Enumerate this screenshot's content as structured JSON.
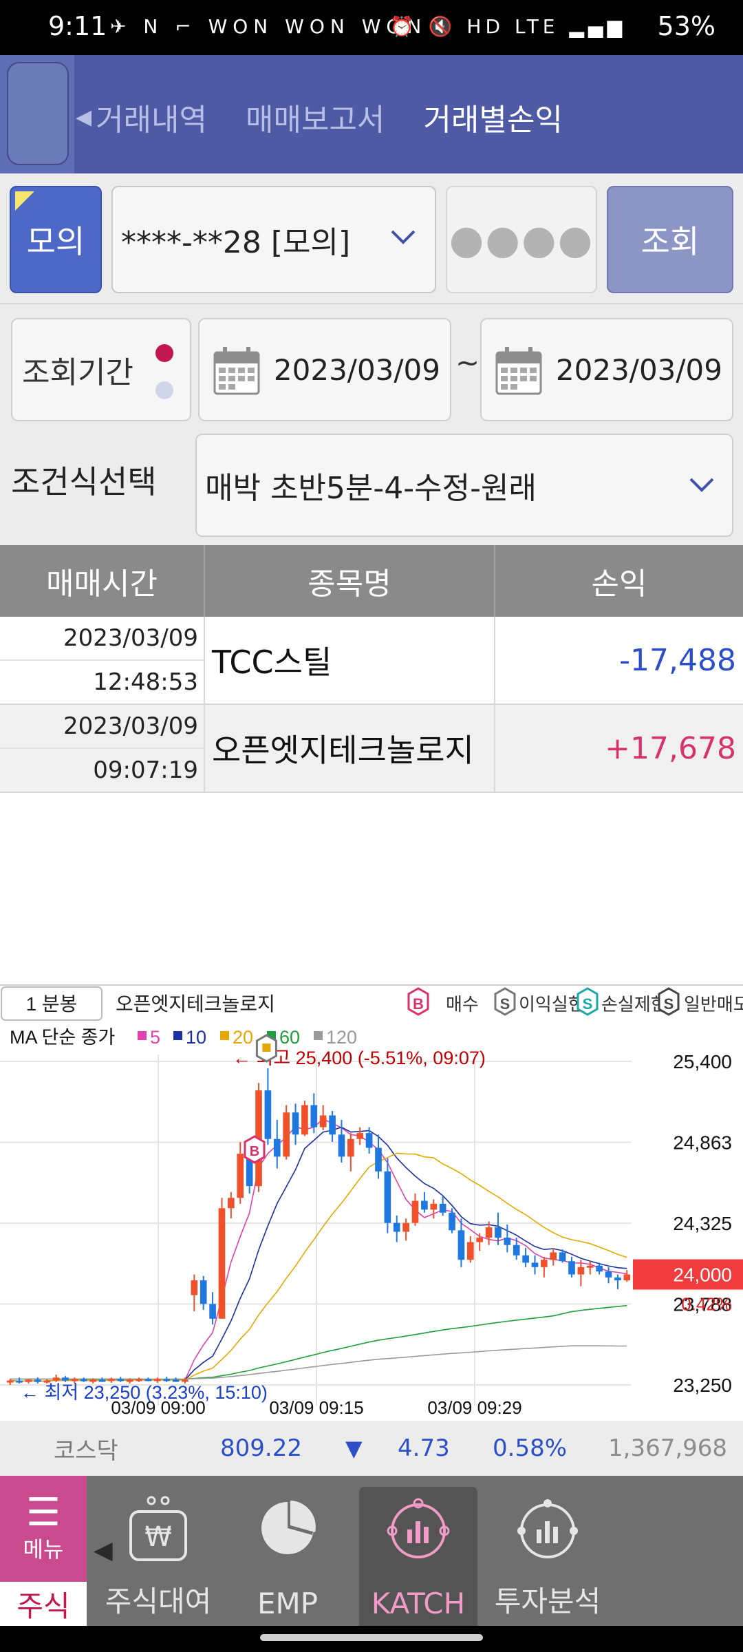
{
  "status_bar": {
    "time": "9:11",
    "notif_icons": "✈ N ⌐ WON WON WON •",
    "right_icons": "⏰ 🔇 HD LTE ▂▄▆",
    "battery": "53%"
  },
  "header": {
    "tabs": [
      {
        "label": "거래내역",
        "active": false
      },
      {
        "label": "매매보고서",
        "active": false
      },
      {
        "label": "거래별손익",
        "active": true
      }
    ]
  },
  "account": {
    "mode_button": "모의",
    "account_value": "****-**28 [모의]",
    "password_mask": "●●●●",
    "query_button": "조회"
  },
  "period": {
    "label": "조회기간",
    "start_date": "2023/03/09",
    "separator": "~",
    "end_date": "2023/03/09"
  },
  "condition": {
    "label": "조건식선택",
    "value": "매박 초반5분-4-수정-원래"
  },
  "table": {
    "headers": [
      "매매시간",
      "종목명",
      "손익"
    ],
    "rows": [
      {
        "date": "2023/03/09",
        "time": "12:48:53",
        "name": "TCC스틸",
        "pnl": "-17,488",
        "sign": "neg"
      },
      {
        "date": "2023/03/09",
        "time": "09:07:19",
        "name": "오픈엣지테크놀로지",
        "pnl": "+17,678",
        "sign": "pos"
      }
    ]
  },
  "chart_data": {
    "type": "candlestick",
    "period_button": "1 분봉",
    "stock_name": "오픈엣지테크놀로지",
    "legend_markers": [
      {
        "icon": "B",
        "label": "매수"
      },
      {
        "icon": "S",
        "label": "이익실현"
      },
      {
        "icon": "S",
        "label": "손실제한"
      },
      {
        "icon": "S",
        "label": "일반매도"
      }
    ],
    "ma_title": "MA 단순 종가",
    "ma_series": [
      {
        "name": "5",
        "color": "#e040b0"
      },
      {
        "name": "10",
        "color": "#1a2fa0"
      },
      {
        "name": "20",
        "color": "#e6a800"
      },
      {
        "name": "60",
        "color": "#1e9e3a"
      },
      {
        "name": "120",
        "color": "#9a9a9a"
      }
    ],
    "y_ticks": [
      "25,400",
      "24,863",
      "24,325",
      "23,788",
      "23,250"
    ],
    "ylim": [
      23250,
      25400
    ],
    "x_ticks": [
      "03/09 09:00",
      "03/09 09:15",
      "03/09 09:29"
    ],
    "high_annotation": "← 최고 25,400 (-5.51%, 09:07)",
    "low_annotation": "← 최저 23,250 (3.23%, 15:10)",
    "current_price": "24,000",
    "current_pct": "0.42%",
    "colors": {
      "up": "#f0502a",
      "down": "#1e78e0"
    },
    "candles": [
      [
        23270,
        23290,
        23250,
        23280
      ],
      [
        23280,
        23300,
        23260,
        23270
      ],
      [
        23270,
        23290,
        23260,
        23285
      ],
      [
        23285,
        23300,
        23260,
        23270
      ],
      [
        23270,
        23290,
        23260,
        23280
      ],
      [
        23280,
        23320,
        23270,
        23300
      ],
      [
        23300,
        23310,
        23270,
        23280
      ],
      [
        23280,
        23300,
        23260,
        23290
      ],
      [
        23290,
        23300,
        23270,
        23275
      ],
      [
        23275,
        23295,
        23260,
        23285
      ],
      [
        23285,
        23300,
        23270,
        23280
      ],
      [
        23280,
        23300,
        23265,
        23290
      ],
      [
        23290,
        23305,
        23270,
        23280
      ],
      [
        23280,
        23295,
        23260,
        23285
      ],
      [
        23285,
        23300,
        23270,
        23290
      ],
      [
        23290,
        23300,
        23275,
        23280
      ],
      [
        23280,
        23300,
        23265,
        23290
      ],
      [
        23290,
        23305,
        23270,
        23285
      ],
      [
        23285,
        23300,
        23270,
        23280
      ],
      [
        23280,
        23300,
        23260,
        23285
      ],
      [
        23860,
        24000,
        23750,
        23960
      ],
      [
        23960,
        23990,
        23760,
        23800
      ],
      [
        23800,
        23880,
        23660,
        23700
      ],
      [
        23700,
        24520,
        23700,
        24450
      ],
      [
        24450,
        24560,
        24380,
        24520
      ],
      [
        24520,
        24900,
        24480,
        24820
      ],
      [
        24820,
        24880,
        24550,
        24600
      ],
      [
        24600,
        25300,
        24560,
        25250
      ],
      [
        25250,
        25400,
        24880,
        24920
      ],
      [
        24920,
        25050,
        24720,
        24800
      ],
      [
        24800,
        25150,
        24780,
        25100
      ],
      [
        25100,
        25160,
        24880,
        24950
      ],
      [
        24950,
        25180,
        24940,
        25150
      ],
      [
        25150,
        25230,
        24960,
        25000
      ],
      [
        25000,
        25150,
        24980,
        25080
      ],
      [
        25080,
        25110,
        24900,
        24950
      ],
      [
        24950,
        25050,
        24760,
        24800
      ],
      [
        24800,
        24960,
        24700,
        24920
      ],
      [
        24920,
        25000,
        24880,
        24960
      ],
      [
        24960,
        25000,
        24820,
        24860
      ],
      [
        24860,
        24950,
        24650,
        24700
      ],
      [
        24700,
        24790,
        24280,
        24350
      ],
      [
        24350,
        24400,
        24220,
        24290
      ],
      [
        24290,
        24380,
        24230,
        24350
      ],
      [
        24350,
        24550,
        24330,
        24500
      ],
      [
        24500,
        24560,
        24420,
        24440
      ],
      [
        24440,
        24510,
        24380,
        24480
      ],
      [
        24480,
        24540,
        24400,
        24420
      ],
      [
        24420,
        24450,
        24280,
        24300
      ],
      [
        24300,
        24380,
        24050,
        24100
      ],
      [
        24100,
        24260,
        24080,
        24220
      ],
      [
        24220,
        24280,
        24160,
        24250
      ],
      [
        24250,
        24360,
        24200,
        24320
      ],
      [
        24320,
        24420,
        24200,
        24250
      ],
      [
        24250,
        24340,
        24150,
        24200
      ],
      [
        24200,
        24250,
        24100,
        24130
      ],
      [
        24130,
        24180,
        24050,
        24080
      ],
      [
        24080,
        24130,
        24000,
        24050
      ],
      [
        24050,
        24120,
        23980,
        24100
      ],
      [
        24100,
        24180,
        24060,
        24150
      ],
      [
        24150,
        24170,
        24080,
        24090
      ],
      [
        24090,
        24120,
        23980,
        24000
      ],
      [
        24000,
        24100,
        23920,
        24050
      ],
      [
        24050,
        24090,
        24000,
        24060
      ],
      [
        24060,
        24080,
        24000,
        24020
      ],
      [
        24020,
        24050,
        23940,
        23980
      ],
      [
        23980,
        24000,
        23900,
        23960
      ],
      [
        23960,
        24030,
        23950,
        24000
      ]
    ]
  },
  "index_ticker": {
    "name": "코스닥",
    "value": "809.22",
    "arrow": "▼",
    "change": "4.73",
    "percent": "0.58%",
    "volume": "1,367,968"
  },
  "bottom_nav": {
    "menu_label": "메뉴",
    "stock_label": "주식",
    "items": [
      {
        "label": "주식대여",
        "icon": "loan-icon",
        "active": false
      },
      {
        "label": "EMP",
        "icon": "pie-chart-icon",
        "active": false
      },
      {
        "label": "KATCH",
        "icon": "bar-chart-icon",
        "active": true
      },
      {
        "label": "투자분석",
        "icon": "analysis-icon",
        "active": false
      }
    ]
  }
}
